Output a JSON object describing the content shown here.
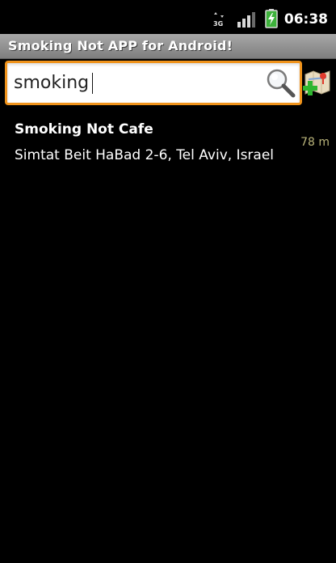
{
  "status_bar": {
    "network_label": "3G",
    "time": "06:38"
  },
  "app": {
    "title": "Smoking Not APP for Android!"
  },
  "search": {
    "value": "smoking",
    "placeholder": ""
  },
  "results": [
    {
      "name": "Smoking Not Cafe",
      "address": "Simtat Beit HaBad 2-6, Tel Aviv, Israel",
      "distance": "78 m"
    }
  ],
  "colors": {
    "search_border": "#f0931b",
    "distance_text": "#b9b47a",
    "battery_fill": "#3db13b",
    "add_icon": "#2fb62f"
  }
}
